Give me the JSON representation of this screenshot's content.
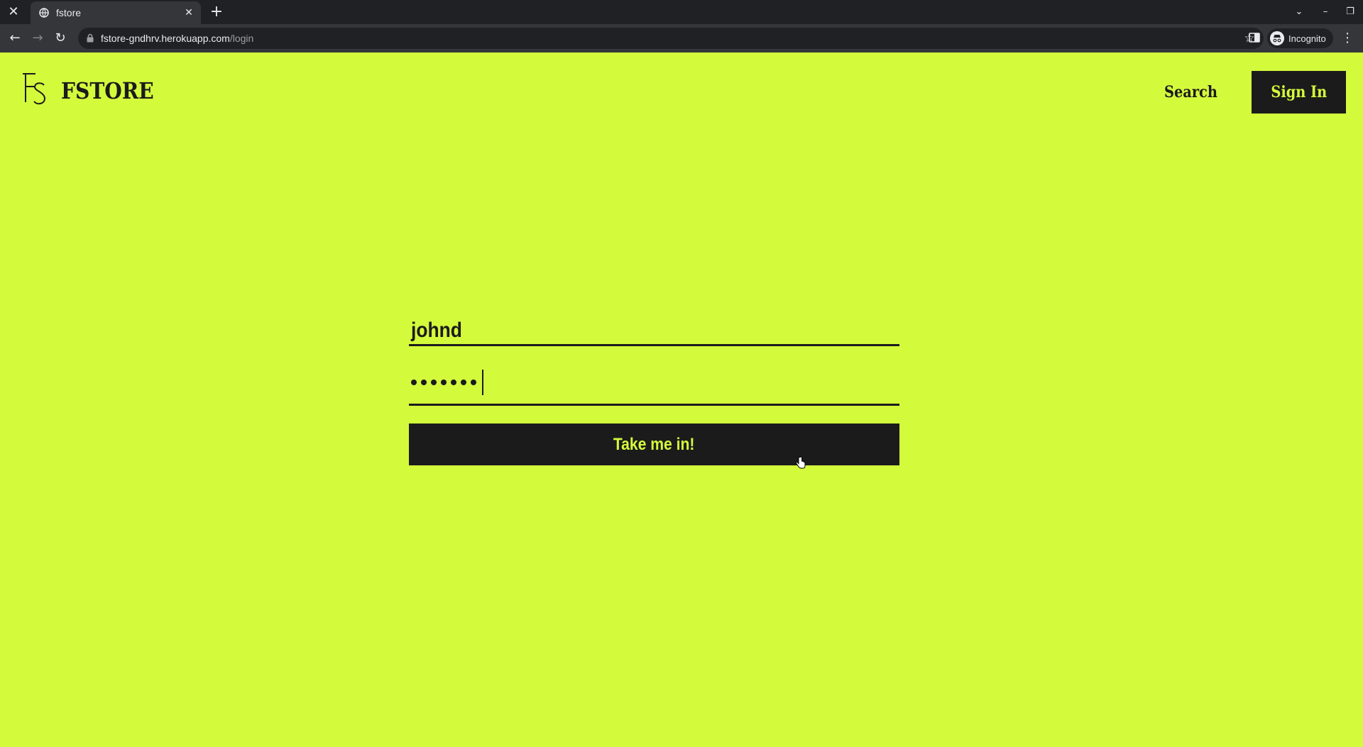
{
  "browser": {
    "tab_title": "fstore",
    "url_host": "fstore-gndhrv.herokuapp.com",
    "url_path": "/login",
    "profile_label": "Incognito",
    "icons": {
      "window_close": "✕",
      "tab_close": "✕",
      "new_tab": "+",
      "back": "←",
      "forward": "→",
      "reload": "↻",
      "star": "☆",
      "menu": "⋮",
      "tab_search": "⌄",
      "minimize": "–",
      "restore": "❐"
    }
  },
  "site": {
    "logo_text": "FSTORE",
    "logo_mark": "FS",
    "nav": {
      "search_label": "Search",
      "signin_label": "Sign In"
    }
  },
  "login_form": {
    "username_value": "johnd",
    "password_dot_count": 7,
    "submit_label": "Take me in!"
  },
  "colors": {
    "page_background": "#d4fa3c",
    "ink": "#1b1b1b",
    "chrome_dark": "#202124",
    "chrome_toolbar": "#35363a"
  }
}
